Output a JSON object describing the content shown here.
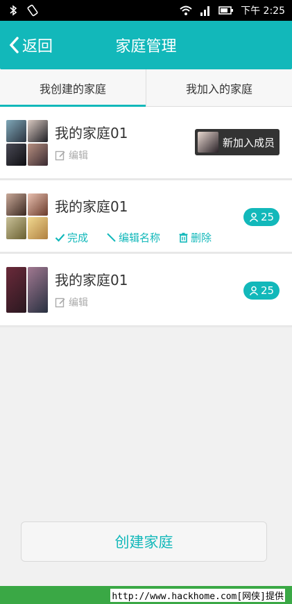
{
  "status_bar": {
    "time": "下午 2:25"
  },
  "header": {
    "back_label": "返回",
    "title": "家庭管理"
  },
  "tabs": [
    {
      "label": "我创建的家庭",
      "active": true
    },
    {
      "label": "我加入的家庭",
      "active": false
    }
  ],
  "families": [
    {
      "name": "我的家庭01",
      "edit_label": "编辑",
      "new_member_label": "新加入成员"
    },
    {
      "name": "我的家庭01",
      "actions": {
        "done_label": "完成",
        "rename_label": "编辑名称",
        "delete_label": "删除"
      },
      "member_count": "25"
    },
    {
      "name": "我的家庭01",
      "edit_label": "编辑",
      "member_count": "25"
    }
  ],
  "create_button_label": "创建家庭",
  "watermark": "http://www.hackhome.com[网侠]提供",
  "colors": {
    "accent": "#12b8ba",
    "statusbar": "#000000",
    "frame": "#3aa845"
  },
  "icons": [
    "bluetooth-icon",
    "rotate-icon",
    "wifi-icon",
    "signal-icon",
    "battery-icon",
    "back-chevron-icon",
    "edit-icon",
    "check-icon",
    "pencil-icon",
    "trash-icon",
    "person-icon"
  ]
}
